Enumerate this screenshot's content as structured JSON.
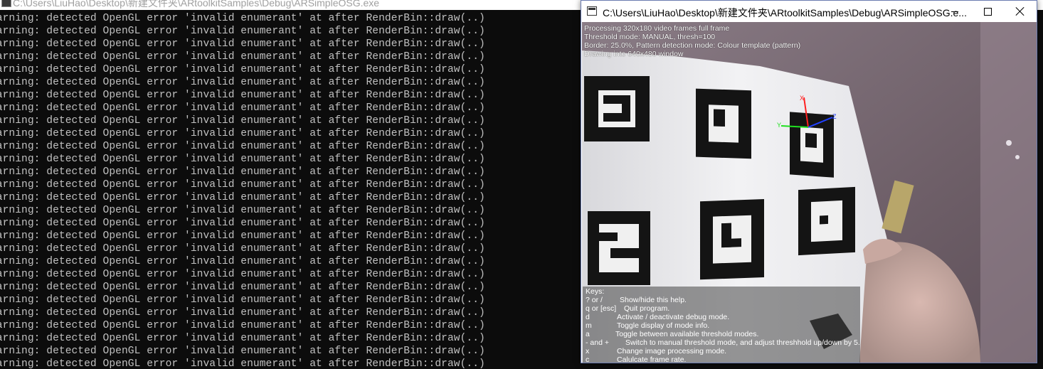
{
  "console": {
    "title": "C:\\Users\\LiuHao\\Desktop\\新建文件夹\\ARtoolkitSamples\\Debug\\ARSimpleOSG.exe",
    "line_text": "Warning: detected OpenGL error 'invalid enumerant' at after RenderBin::draw(..)",
    "line_count": 28
  },
  "ar_window": {
    "title": "C:\\Users\\LiuHao\\Desktop\\新建文件夹\\ARtoolkitSamples\\Debug\\ARSimpleOSG.e...",
    "minimize_label": "",
    "maximize_label": "",
    "close_label": ""
  },
  "info": [
    "Processing 320x180 video frames full frame",
    "Threshold mode: MANUAL, thresh=100",
    "Border: 25.0%, Pattern detection mode: Colour template (pattern)",
    "Drawing into 640x480 window"
  ],
  "help": {
    "heading": "Keys:",
    "rows": [
      {
        "key": "? or /",
        "desc": "Show/hide this help."
      },
      {
        "key": "q or [esc]",
        "desc": "Quit program."
      },
      {
        "key": "d",
        "desc": "Activate / deactivate debug mode."
      },
      {
        "key": "m",
        "desc": "Toggle display of mode info."
      },
      {
        "key": "a",
        "desc": "Toggle between available threshold modes."
      },
      {
        "key": "- and +",
        "desc": "Switch to manual threshold mode, and adjust threshhold up/down by 5."
      },
      {
        "key": "x",
        "desc": "Change image processing mode."
      },
      {
        "key": "c",
        "desc": "Calulcate frame rate."
      }
    ]
  },
  "axes": {
    "x": "X",
    "y": "Y",
    "z": "Z"
  },
  "colors": {
    "console_bg": "#0c0c0c",
    "console_text": "#c0c0c0",
    "axis_x": "#ff2020",
    "axis_y": "#20e020",
    "axis_z": "#2040ff"
  }
}
